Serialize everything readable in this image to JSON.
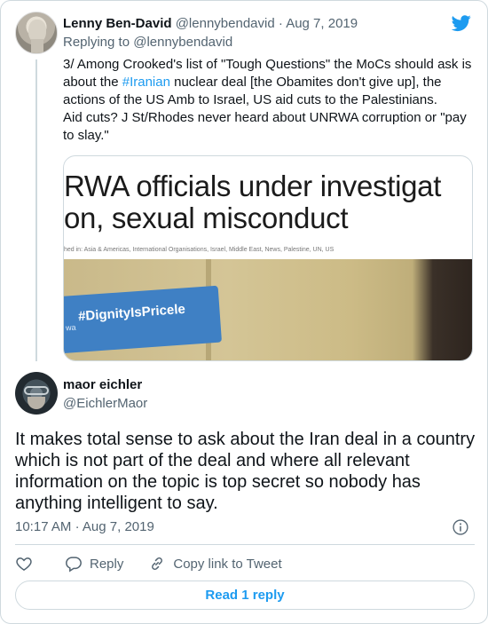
{
  "parent_tweet": {
    "name": "Lenny Ben-David",
    "handle": "@lennybendavid",
    "separator": "·",
    "date": "Aug 7, 2019",
    "replying_prefix": "Replying to",
    "replying_handle": "@lennybendavid",
    "text_before_hashtag": "3/ Among Crooked's list of \"Tough Questions\" the MoCs should ask is about the ",
    "hashtag": "#Iranian",
    "text_after_hashtag": " nuclear deal [the Obamites don't give up], the actions of the US Amb to Israel, US aid cuts to the Palestinians.",
    "text_second_paragraph": "Aid cuts? J St/Rhodes never heard about UNRWA corruption or \"pay to slay.\"",
    "media": {
      "headline_line1": "RWA officials under investigat",
      "headline_line2": "on, sexual misconduct",
      "meta": "hed in: Asia & Americas, International Organisations, Israel, Middle East, News, Palestine, UN, US",
      "sticker_text": "#DignityIsPricele",
      "sticker_sub": "wa"
    }
  },
  "main_tweet": {
    "name": "maor eichler",
    "handle": "@EichlerMaor",
    "text": "It makes total sense to ask about the Iran deal in a country which is not part of the deal and where all relevant information on the topic is top secret so nobody has anything intelligent to say.",
    "time": "10:17 AM",
    "separator": "·",
    "date": "Aug 7, 2019"
  },
  "actions": {
    "like_icon": "heart-icon",
    "reply_label": "Reply",
    "copy_label": "Copy link to Tweet"
  },
  "read_replies_label": "Read 1 reply",
  "colors": {
    "accent": "#1d9bf0",
    "muted": "#536471",
    "border": "#cfd9de"
  }
}
